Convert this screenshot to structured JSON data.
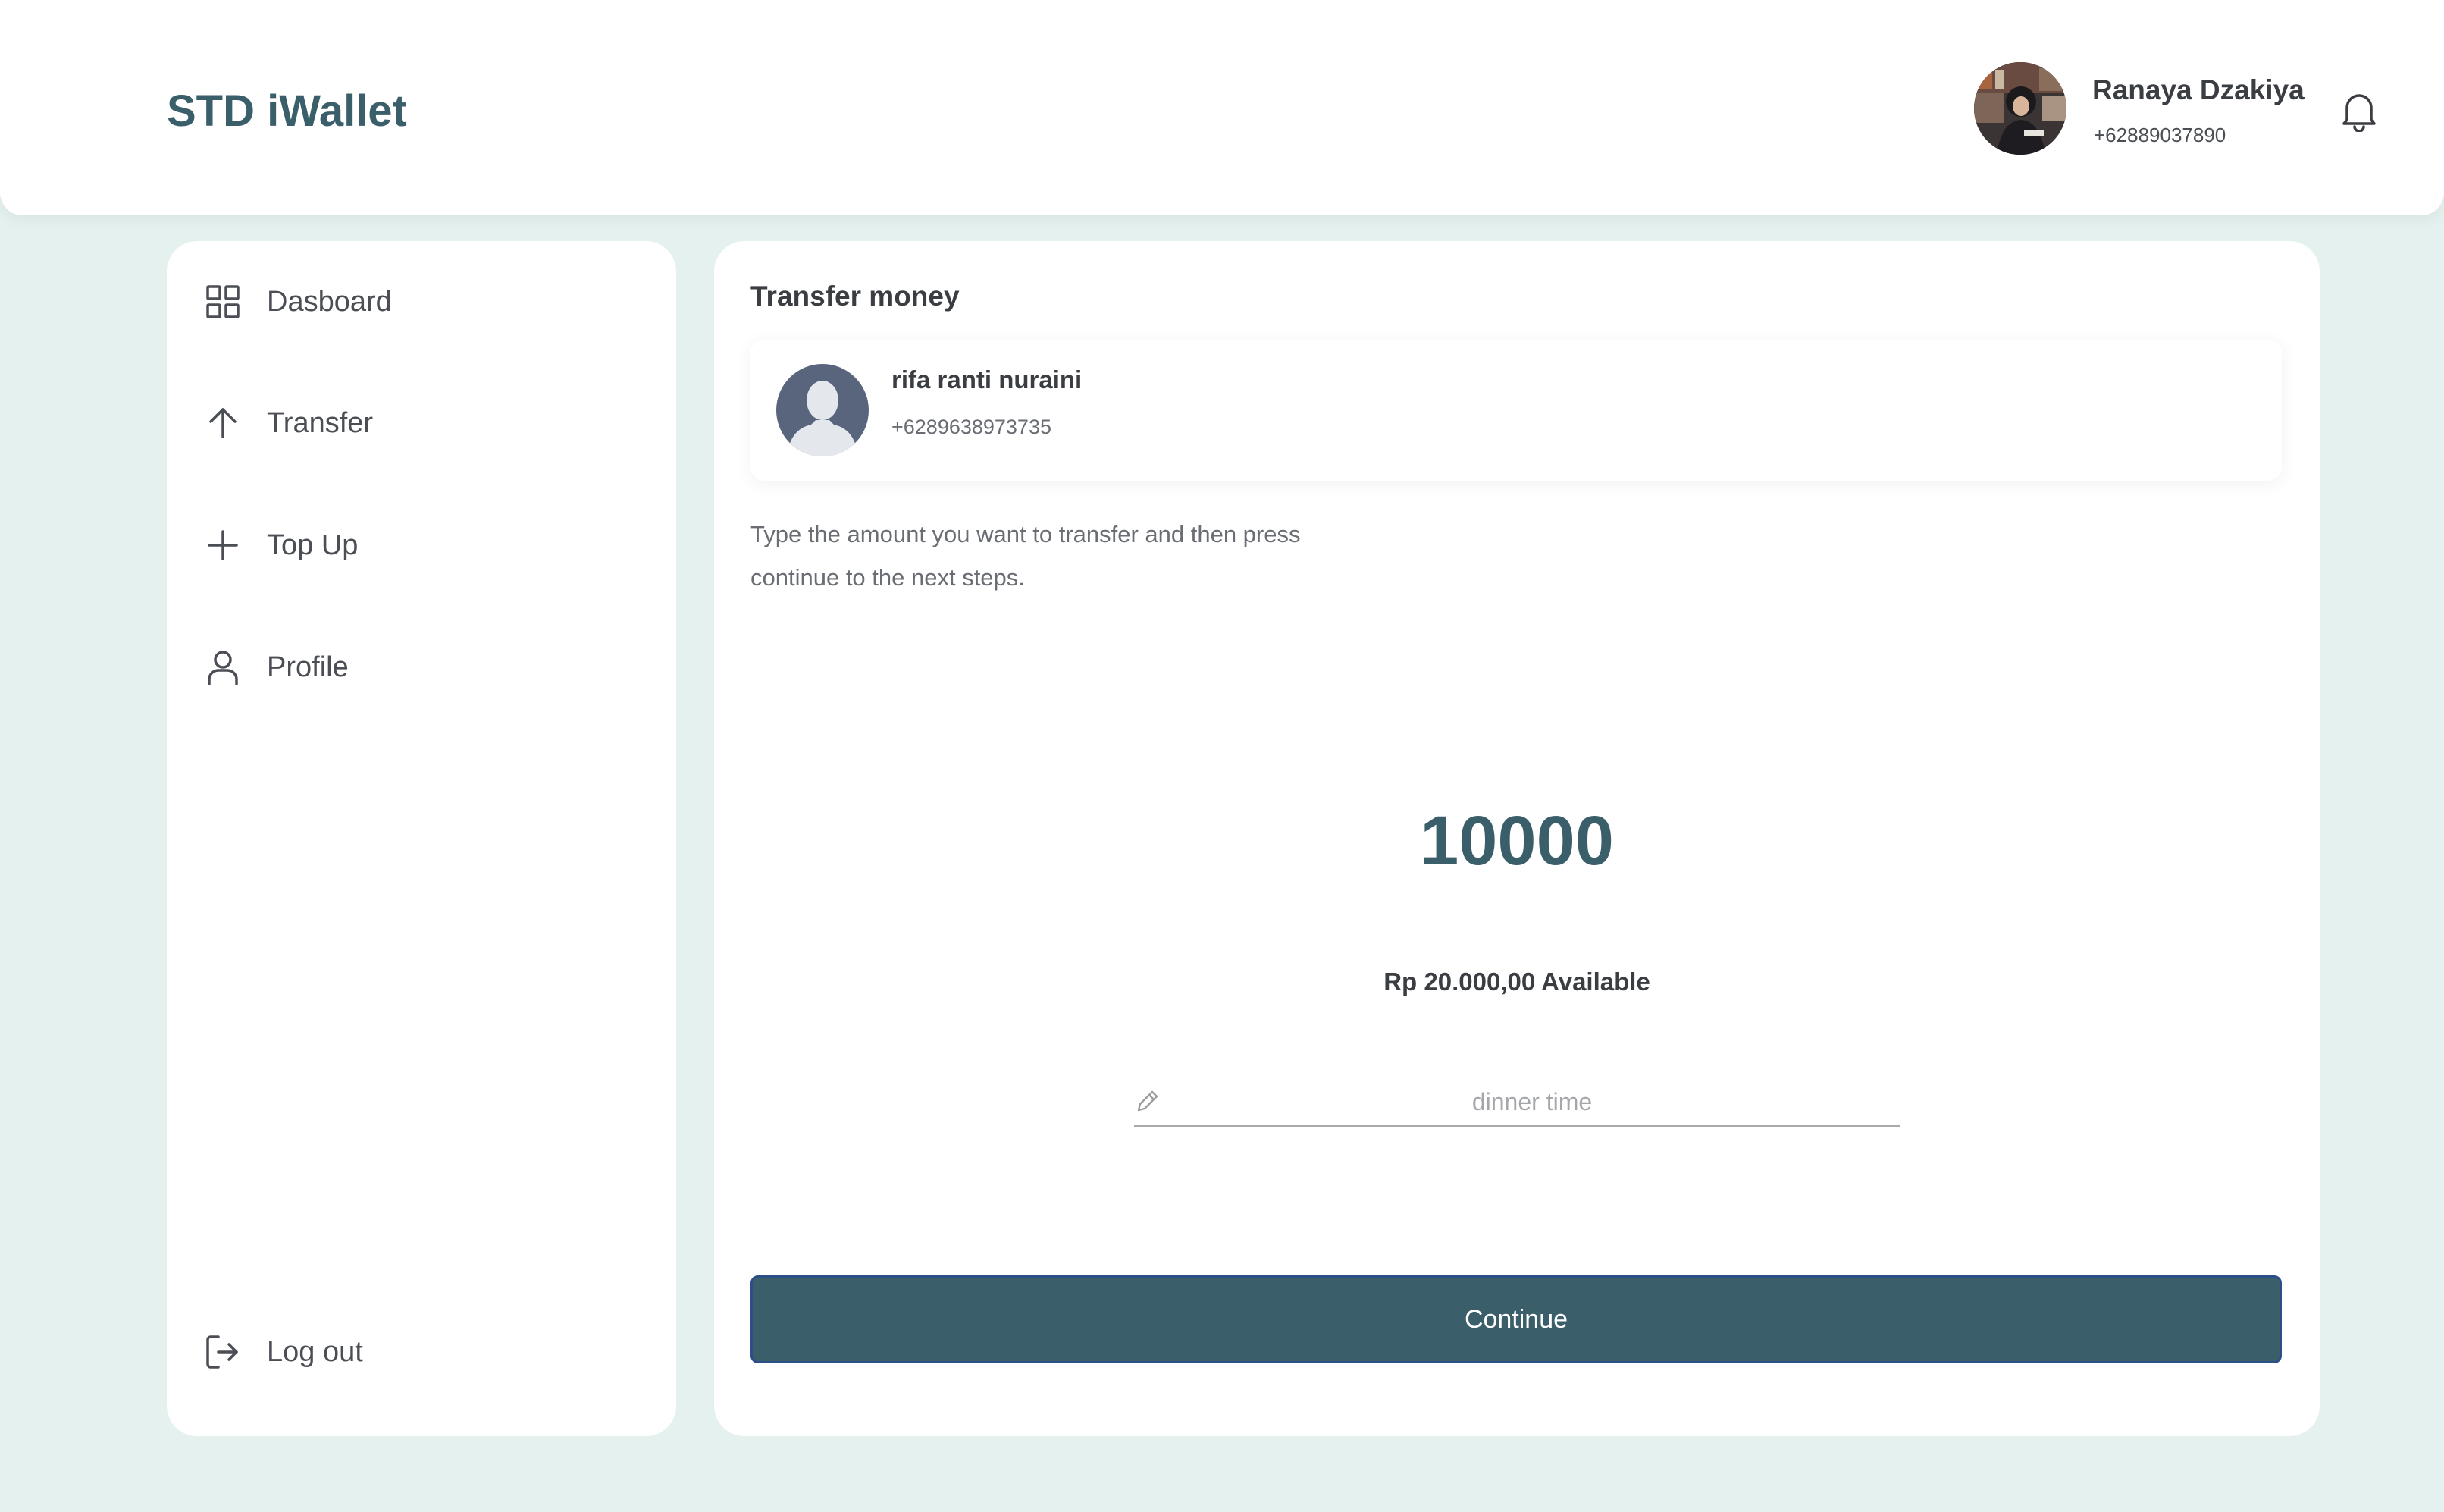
{
  "header": {
    "brand": "STD iWallet",
    "user": {
      "name": "Ranaya Dzakiya",
      "phone": "+62889037890"
    }
  },
  "sidebar": {
    "items": [
      {
        "label": "Dasboard",
        "icon": "grid-icon"
      },
      {
        "label": "Transfer",
        "icon": "arrow-up-icon"
      },
      {
        "label": "Top Up",
        "icon": "plus-icon"
      },
      {
        "label": "Profile",
        "icon": "user-icon"
      }
    ],
    "logout": {
      "label": "Log out",
      "icon": "logout-icon"
    }
  },
  "main": {
    "title": "Transfer money",
    "recipient": {
      "name": "rifa ranti nuraini",
      "phone": "+6289638973735"
    },
    "instructions": "Type the amount you want to transfer and then press continue to the next steps.",
    "amount": "10000",
    "available": "Rp 20.000,00 Available",
    "notes": {
      "value": "",
      "placeholder": "dinner time"
    },
    "continue_label": "Continue"
  },
  "colors": {
    "background": "#e5f1ee",
    "accent": "#3a5f6a",
    "button_border": "#2c4f8a",
    "panel": "#ffffff"
  }
}
